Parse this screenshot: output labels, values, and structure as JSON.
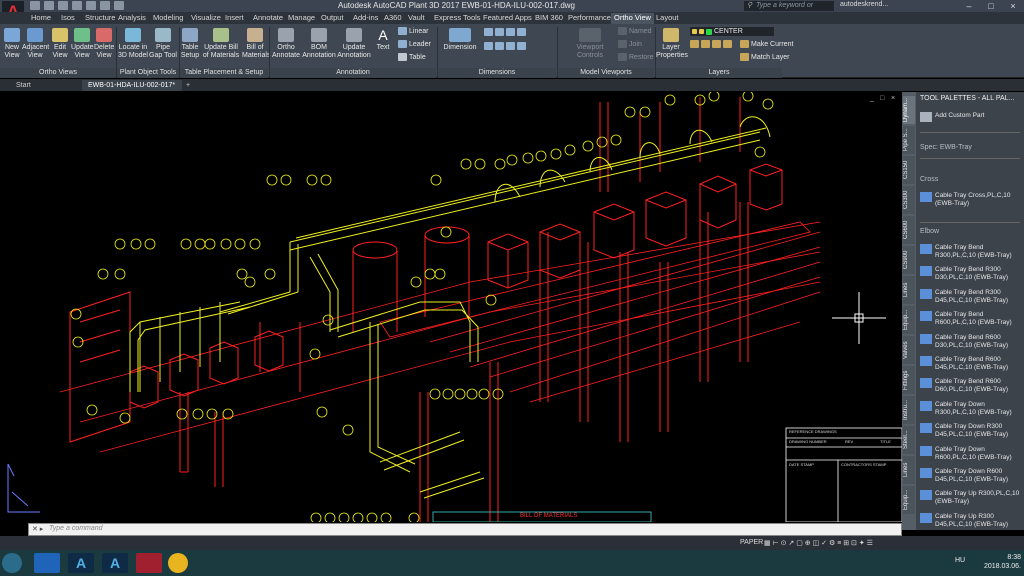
{
  "app": {
    "logo_text": "A",
    "logo_badge": "P3D",
    "title": "Autodesk AutoCAD Plant 3D 2017    EWB-01-HDA-ILU-002-017.dwg",
    "search_placeholder": "Type a keyword or phrase",
    "user": "autodeskrend..."
  },
  "ribbon_tabs": [
    "Home",
    "Isos",
    "Structure",
    "Analysis",
    "Modeling",
    "Visualize",
    "Insert",
    "Annotate",
    "Manage",
    "Output",
    "Add-ins",
    "A360",
    "Vault",
    "Express Tools",
    "Featured Apps",
    "BIM 360",
    "Performance",
    "Ortho View",
    "Layout"
  ],
  "active_tab": "Ortho View",
  "ribbon": {
    "ortho_views": {
      "label": "Ortho Views",
      "buttons": [
        "New View",
        "Adjacent View",
        "Edit View",
        "Update View",
        "Delete View"
      ]
    },
    "plant_object_tools": {
      "label": "Plant Object Tools",
      "buttons": [
        "Locate in 3D Model",
        "Pipe Gap Tool"
      ]
    },
    "table": {
      "label": "Table Placement & Setup",
      "buttons": [
        "Table Setup",
        "Update Bill of Materials",
        "Bill of Materials"
      ]
    },
    "annotation": {
      "label": "Annotation",
      "buttons": [
        "Ortho Annotate",
        "BOM Annotation",
        "Update Annotation",
        "Text"
      ],
      "small": [
        "Linear",
        "Leader",
        "Table"
      ]
    },
    "dimensions": {
      "label": "Dimensions",
      "buttons": [
        "Dimension"
      ]
    },
    "model_viewports": {
      "label": "Model Viewports",
      "buttons": [
        "Viewport Controls"
      ],
      "small": [
        "Named",
        "Join",
        "Restore"
      ]
    },
    "layers": {
      "label": "Layers",
      "buttons": [
        "Layer Properties"
      ],
      "current_layer": "CENTER",
      "small": [
        "Make Current",
        "Match Layer"
      ]
    }
  },
  "doc_tabs": [
    "Start",
    "EWB-01-HDA-ILU-002-017*"
  ],
  "viewport_controls": [
    "_",
    "□",
    "×"
  ],
  "palette": {
    "title": "TOOL PALETTES - ALL PAL...",
    "add_custom_part": "Add Custom Part",
    "spec": "Spec: EWB-Tray",
    "sections": [
      "Cross",
      "Elbow"
    ],
    "cross_items": [
      "Cable Tray Cross,PL,C,10 (EWB-Tray)"
    ],
    "elbow_items": [
      "Cable Tray Bend R300,PL,C,10 (EWB-Tray)",
      "Cable Tray Bend R300 D30,PL,C,10 (EWB-Tray)",
      "Cable Tray Bend R300 D45,PL,C,10 (EWB-Tray)",
      "Cable Tray Bend R600,PL,C,10 (EWB-Tray)",
      "Cable Tray Bend R600 D30,PL,C,10 (EWB-Tray)",
      "Cable Tray Bend R600 D45,PL,C,10 (EWB-Tray)",
      "Cable Tray Bend R600 D60,PL,C,10 (EWB-Tray)",
      "Cable Tray Down R300,PL,C,10 (EWB-Tray)",
      "Cable Tray Down R300 D45,PL,C,10 (EWB-Tray)",
      "Cable Tray Down R600,PL,C,10 (EWB-Tray)",
      "Cable Tray Down R600 D45,PL,C,10 (EWB-Tray)",
      "Cable Tray Up R300,PL,C,10 (EWB-Tray)",
      "Cable Tray Up R300 D45,PL,C,10 (EWB-Tray)"
    ],
    "strip_tabs": [
      "Dynam...",
      "Pipe S...",
      "CS150",
      "CS300",
      "CS600",
      "CS900",
      "Lines",
      "Equip...",
      "Valves",
      "Fittings",
      "Instru...",
      "Steel...",
      "Lines",
      "Equip..."
    ]
  },
  "command_line": {
    "placeholder": "Type a command"
  },
  "status": {
    "space": "PAPER"
  },
  "bom_title": "BILL OF MATERIALS",
  "title_block_labels": [
    "REFERENCE DRAWINGS",
    "DRAWING NUMBER",
    "REV",
    "TITLE",
    "DATE STAMP",
    "CONTRACTORS STAMP"
  ],
  "taskbar": {
    "lang": "HU",
    "time": "8:38",
    "date": "2018.03.06."
  },
  "colors": {
    "structure": "#ff2020",
    "tray": "#f0f020",
    "crosshair": "#ffffff"
  }
}
